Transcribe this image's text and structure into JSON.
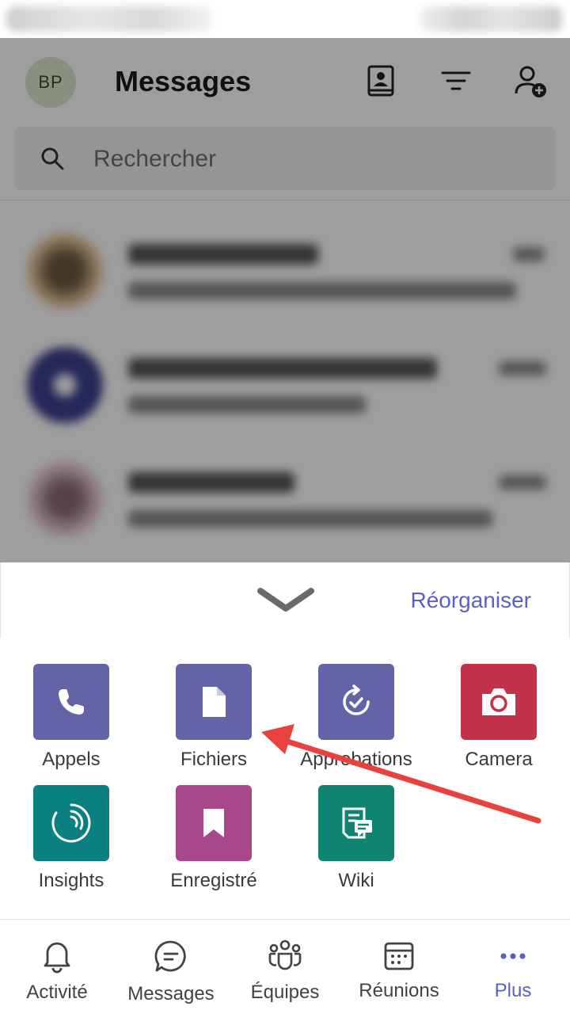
{
  "header": {
    "avatar_initials": "BP",
    "title": "Messages",
    "icons": [
      "contacts-icon",
      "filter-icon",
      "add-person-icon"
    ]
  },
  "search": {
    "placeholder": "Rechercher"
  },
  "sheet": {
    "reorganize_label": "Réorganiser",
    "apps": [
      {
        "label": "Appels",
        "icon": "phone-icon",
        "color": "#6264a7"
      },
      {
        "label": "Fichiers",
        "icon": "file-icon",
        "color": "#6264a7"
      },
      {
        "label": "Approbations",
        "icon": "approvals-icon",
        "color": "#6264a7"
      },
      {
        "label": "Camera",
        "icon": "camera-icon",
        "color": "#c4314b"
      },
      {
        "label": "Insights",
        "icon": "insights-icon",
        "color": "#0a8080"
      },
      {
        "label": "Enregistré",
        "icon": "bookmark-icon",
        "color": "#a8488a"
      },
      {
        "label": "Wiki",
        "icon": "wiki-icon",
        "color": "#0e8471"
      }
    ]
  },
  "bottom_nav": [
    {
      "label": "Activité",
      "icon": "bell-icon"
    },
    {
      "label": "Messages",
      "icon": "chat-icon"
    },
    {
      "label": "Équipes",
      "icon": "teams-icon"
    },
    {
      "label": "Réunions",
      "icon": "calendar-icon"
    },
    {
      "label": "Plus",
      "icon": "more-icon",
      "active": true
    }
  ],
  "colors": {
    "accent": "#5b5fc7",
    "annotation_arrow": "#e8413e"
  }
}
